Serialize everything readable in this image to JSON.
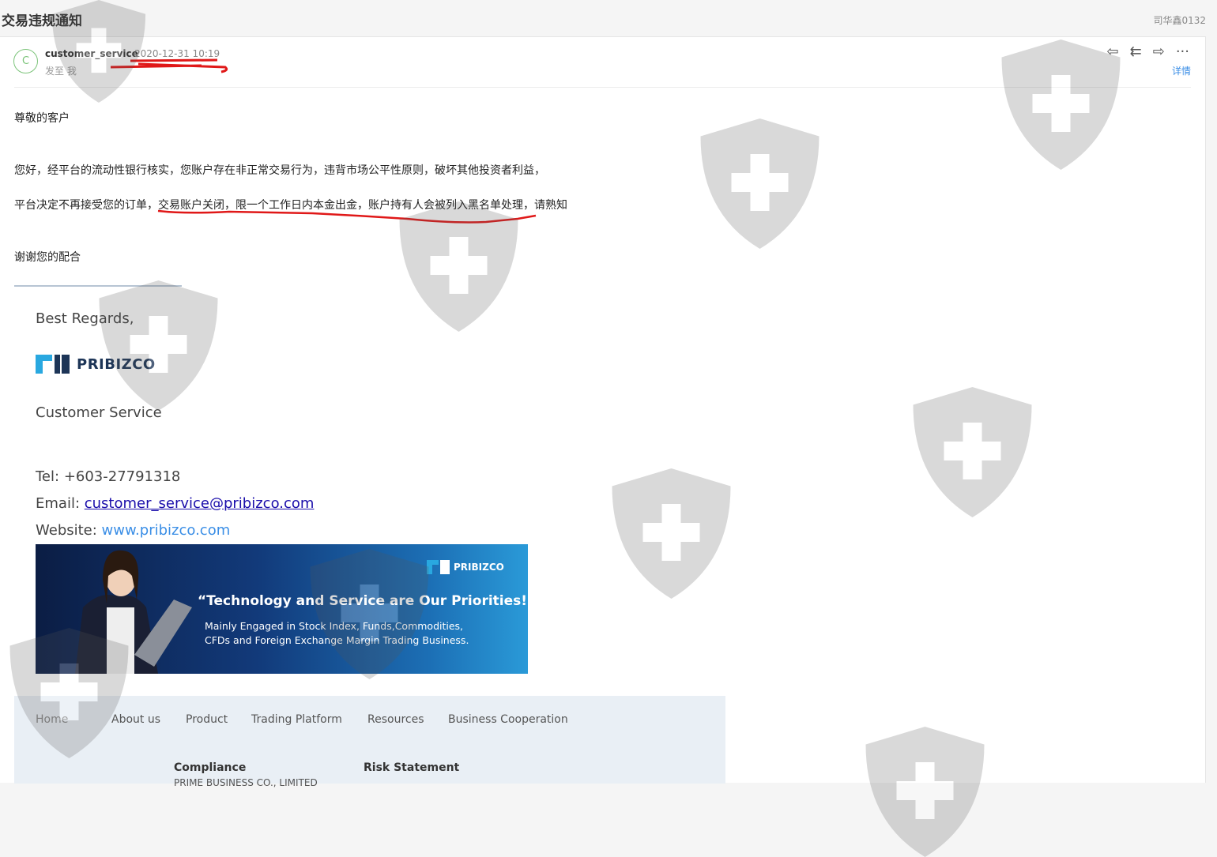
{
  "window": {
    "subject": "交易违规通知",
    "account": "司华鑫0132"
  },
  "header": {
    "avatar_letter": "C",
    "sender": "customer_service",
    "date": "2020-12-31 10:19",
    "to": "发至 我",
    "detail_link": "详情",
    "actions": [
      {
        "icon": "reply-icon",
        "glyph": "⇦"
      },
      {
        "icon": "reply-all-icon",
        "glyph": "⇇"
      },
      {
        "icon": "forward-icon",
        "glyph": "⇨"
      },
      {
        "icon": "more-icon",
        "glyph": "···"
      }
    ]
  },
  "body": {
    "greeting": "尊敬的客户",
    "para1": "您好，经平台的流动性银行核实，您账户存在非正常交易行为，违背市场公平性原则，破坏其他投资者利益，",
    "para2": "平台决定不再接受您的订单，交易账户关闭，限一个工作日内本金出金，账户持有人会被列入黑名单处理，请熟知",
    "closing": "谢谢您的配合"
  },
  "signature": {
    "regards": "Best Regards,",
    "logo_text": "PRIBIZCO",
    "role": "Customer Service",
    "tel_label": "Tel: ",
    "tel": "+603-27791318",
    "email_label": "Email: ",
    "email": "customer_service@pribizco.com",
    "website_label": "Website: ",
    "website": "www.pribizco.com"
  },
  "banner": {
    "logo": "PRIBIZCO",
    "quote": "“Technology and Service are Our Priorities!”",
    "line1": "Mainly Engaged in Stock Index, Funds,Commodities,",
    "line2": "CFDs and Foreign Exchange Margin Trading Business."
  },
  "footer": {
    "nav": [
      "Home",
      "About us",
      "Product",
      "Trading Platform",
      "Resources",
      "Business Cooperation"
    ],
    "compliance_title": "Compliance",
    "compliance_text": "PRIME BUSINESS CO., LIMITED",
    "risk_title": "Risk Statement"
  }
}
